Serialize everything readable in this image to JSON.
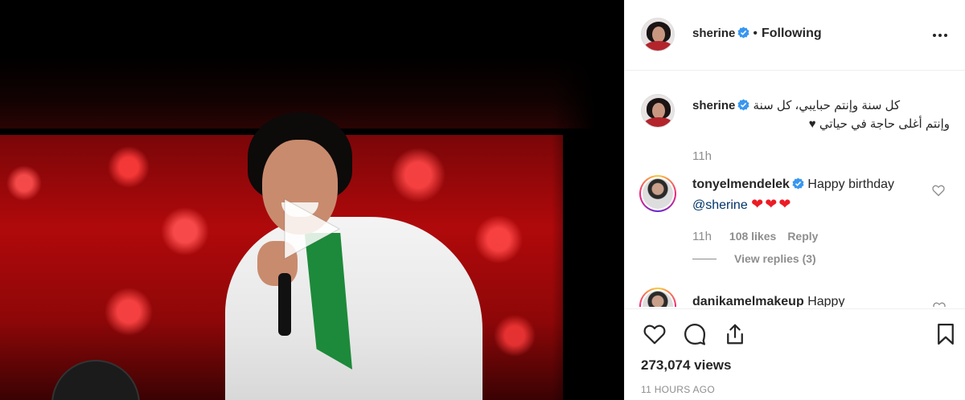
{
  "post": {
    "username": "sherine",
    "follow_status": "Following",
    "views": "273,074 views",
    "posted_ago": "11 HOURS AGO"
  },
  "caption": {
    "username": "sherine",
    "line1": "كل سنة وإنتم حبايبي، كل سنة",
    "line2": "وإنتم أغلى حاجة في حياتي ♥",
    "time": "11h"
  },
  "comments": [
    {
      "username": "tonyelmendelek",
      "text": "Happy birthday",
      "mention": "@sherine",
      "emoji": "❤❤❤",
      "time": "11h",
      "likes": "108 likes",
      "reply": "Reply",
      "view_replies": "View replies (3)"
    },
    {
      "username": "danikamelmakeup",
      "text": "Happy"
    }
  ],
  "icons": {
    "verified": "verified-badge-icon",
    "more": "more-options-icon",
    "play": "play-icon",
    "like": "heart-icon",
    "comment": "comment-icon",
    "share": "share-icon",
    "save": "bookmark-icon"
  },
  "colors": {
    "verified_blue": "#3897f0",
    "text_primary": "#262626",
    "text_secondary": "#8e8e8e",
    "mention": "#003569",
    "heart_red": "#ed1b24"
  }
}
